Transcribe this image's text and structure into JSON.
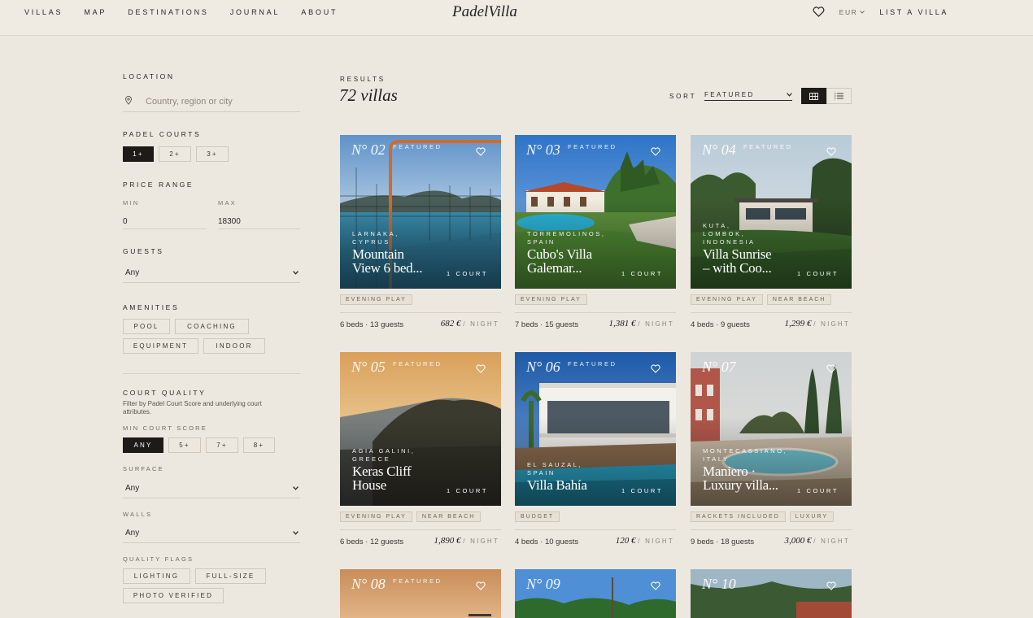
{
  "header": {
    "nav": [
      "VILLAS",
      "MAP",
      "DESTINATIONS",
      "JOURNAL",
      "ABOUT"
    ],
    "logo": "PadelVilla",
    "currency": "EUR",
    "list_villa": "LIST A VILLA"
  },
  "filters": {
    "location_label": "LOCATION",
    "location_placeholder": "Country, region or city",
    "padel_courts_label": "PADEL COURTS",
    "court_options": [
      "1+",
      "2+",
      "3+"
    ],
    "price_range_label": "PRICE RANGE",
    "min_label": "MIN",
    "max_label": "MAX",
    "min_value": "0",
    "max_value": "18300",
    "guests_label": "GUESTS",
    "guests_value": "Any",
    "amenities_label": "AMENITIES",
    "amenities": [
      "POOL",
      "COACHING",
      "EQUIPMENT",
      "INDOOR"
    ],
    "court_quality_label": "COURT QUALITY",
    "court_quality_desc": "Filter by Padel Court Score and underlying court attributes.",
    "min_score_label": "MIN COURT SCORE",
    "score_options": [
      "ANY",
      "5+",
      "7+",
      "8+"
    ],
    "surface_label": "SURFACE",
    "surface_value": "Any",
    "walls_label": "WALLS",
    "walls_value": "Any",
    "quality_flags_label": "QUALITY FLAGS",
    "quality_flags": [
      "LIGHTING",
      "FULL-SIZE",
      "PHOTO VERIFIED"
    ]
  },
  "results": {
    "label": "RESULTS",
    "count": "72 villas",
    "sort_label": "SORT",
    "sort_value": "FEATURED"
  },
  "villas": [
    {
      "num": "N° 02",
      "featured": "FEATURED",
      "location": [
        "LARNAKA,",
        "CYPRUS"
      ],
      "name": [
        "Mountain",
        "View 6 bed..."
      ],
      "courts": "1 COURT",
      "tags": [
        "EVENING PLAY"
      ],
      "meta": "6 beds · 13 guests",
      "price": "682 €",
      "per": "/ NIGHT"
    },
    {
      "num": "N° 03",
      "featured": "FEATURED",
      "location": [
        "TORREMOLINOS,",
        "SPAIN"
      ],
      "name": [
        "Cubo's Villa",
        "Galemar..."
      ],
      "courts": "1 COURT",
      "tags": [
        "EVENING PLAY"
      ],
      "meta": "7 beds · 15 guests",
      "price": "1,381 €",
      "per": "/ NIGHT"
    },
    {
      "num": "N° 04",
      "featured": "FEATURED",
      "location": [
        "KUTA,",
        "LOMBOK,",
        "INDONESIA"
      ],
      "name": [
        "Villa Sunrise",
        "– with Coo..."
      ],
      "courts": "1 COURT",
      "tags": [
        "EVENING PLAY",
        "NEAR BEACH"
      ],
      "meta": "4 beds · 9 guests",
      "price": "1,299 €",
      "per": "/ NIGHT"
    },
    {
      "num": "N° 05",
      "featured": "FEATURED",
      "location": [
        "AGIA GALINI,",
        "GREECE"
      ],
      "name": [
        "Keras Cliff",
        "House"
      ],
      "courts": "1 COURT",
      "tags": [
        "EVENING PLAY",
        "NEAR BEACH"
      ],
      "meta": "6 beds · 12 guests",
      "price": "1,890 €",
      "per": "/ NIGHT"
    },
    {
      "num": "N° 06",
      "featured": "FEATURED",
      "location": [
        "EL SAUZAL,",
        "SPAIN"
      ],
      "name": [
        "Villa Bahía",
        ""
      ],
      "courts": "1 COURT",
      "tags": [
        "BUDGET"
      ],
      "meta": "4 beds · 10 guests",
      "price": "120 €",
      "per": "/ NIGHT"
    },
    {
      "num": "N° 07",
      "featured": "",
      "location": [
        "MONTECASSIANO,",
        "ITALY"
      ],
      "name": [
        "Maniero ·",
        "Luxury villa..."
      ],
      "courts": "1 COURT",
      "tags": [
        "RACKETS INCLUDED",
        "LUXURY"
      ],
      "meta": "9 beds · 18 guests",
      "price": "3,000 €",
      "per": "/ NIGHT"
    },
    {
      "num": "N° 08",
      "featured": "FEATURED"
    },
    {
      "num": "N° 09",
      "featured": ""
    },
    {
      "num": "N° 10",
      "featured": ""
    }
  ],
  "colors": {
    "background": "#ede8df",
    "ink": "#1d1a17",
    "tag_bg": "#e6e0d5"
  }
}
